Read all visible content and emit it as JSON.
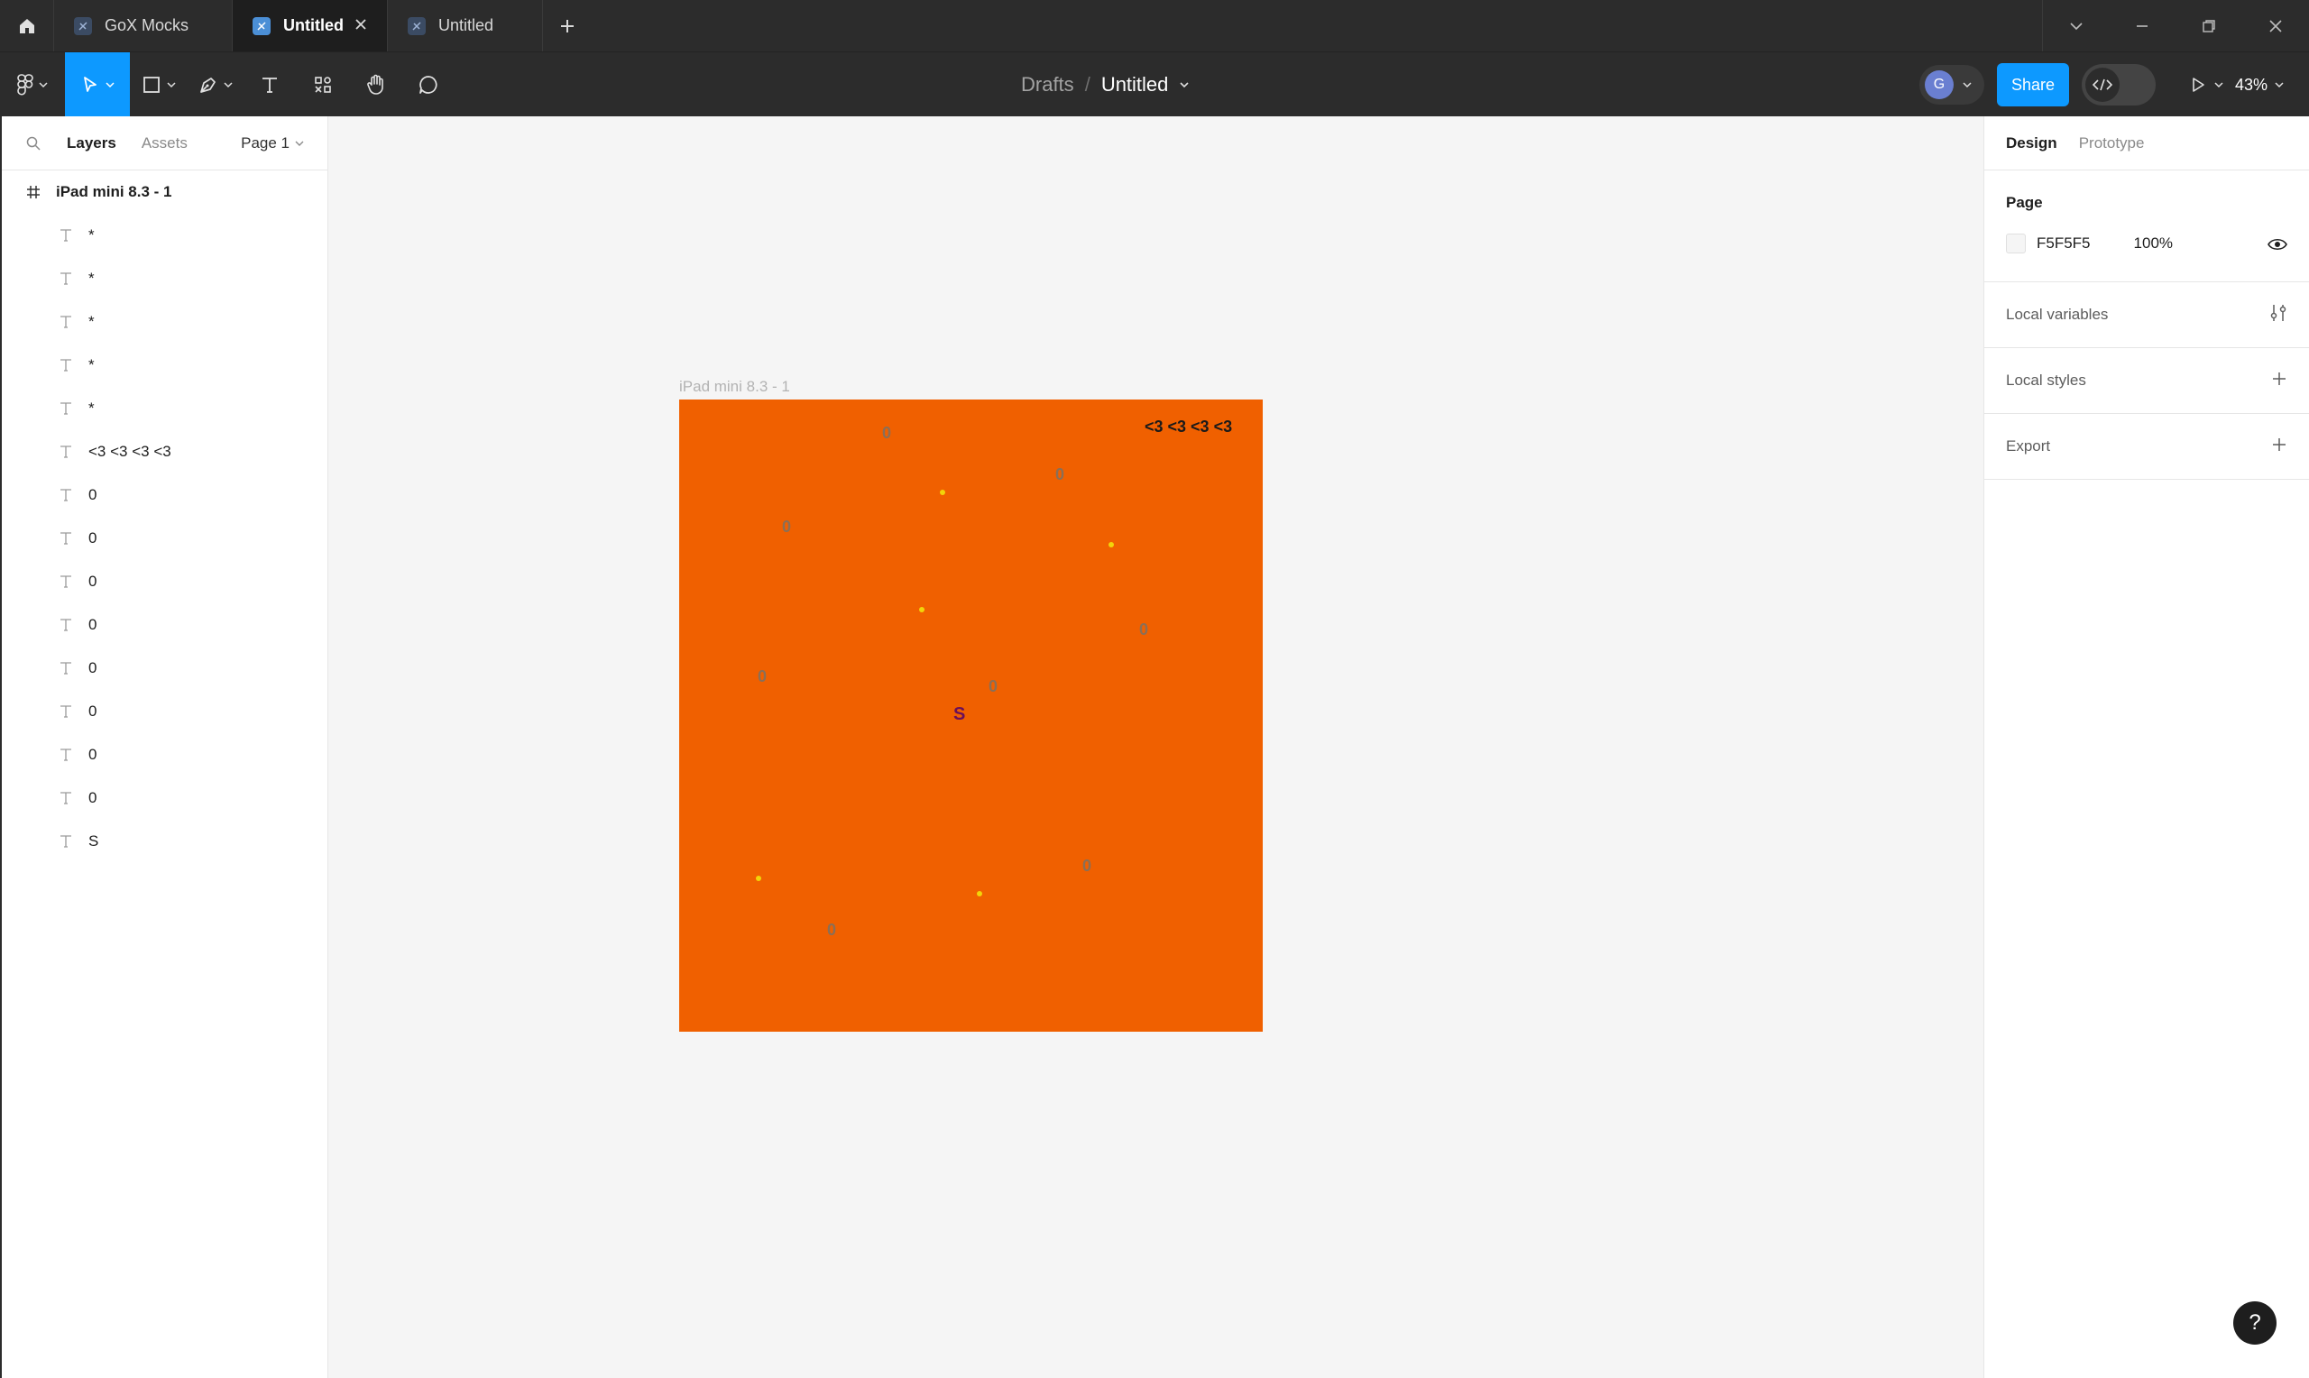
{
  "tabs": [
    {
      "label": "GoX Mocks",
      "active": false
    },
    {
      "label": "Untitled",
      "active": true
    },
    {
      "label": "Untitled",
      "active": false
    }
  ],
  "breadcrumb": {
    "folder": "Drafts",
    "separator": "/",
    "file": "Untitled"
  },
  "toolbar": {
    "share_label": "Share",
    "zoom": "43%",
    "avatar_initial": "G"
  },
  "left_panel": {
    "tab_layers": "Layers",
    "tab_assets": "Assets",
    "page_selector": "Page 1",
    "root_layer": "iPad mini 8.3 - 1",
    "layers": [
      "*",
      "*",
      "*",
      "*",
      "*",
      "<3 <3 <3 <3",
      "0",
      "0",
      "0",
      "0",
      "0",
      "0",
      "0",
      "0",
      "S"
    ]
  },
  "canvas": {
    "frame_label": "iPad mini 8.3 - 1",
    "frame_color": "#F06000",
    "hearts_text": "<3 <3 <3 <3",
    "zero_text": "0",
    "player_text": "S"
  },
  "right_panel": {
    "tab_design": "Design",
    "tab_prototype": "Prototype",
    "page_heading": "Page",
    "page_color": "F5F5F5",
    "page_opacity": "100%",
    "local_variables": "Local variables",
    "local_styles": "Local styles",
    "export": "Export"
  },
  "help_label": "?"
}
